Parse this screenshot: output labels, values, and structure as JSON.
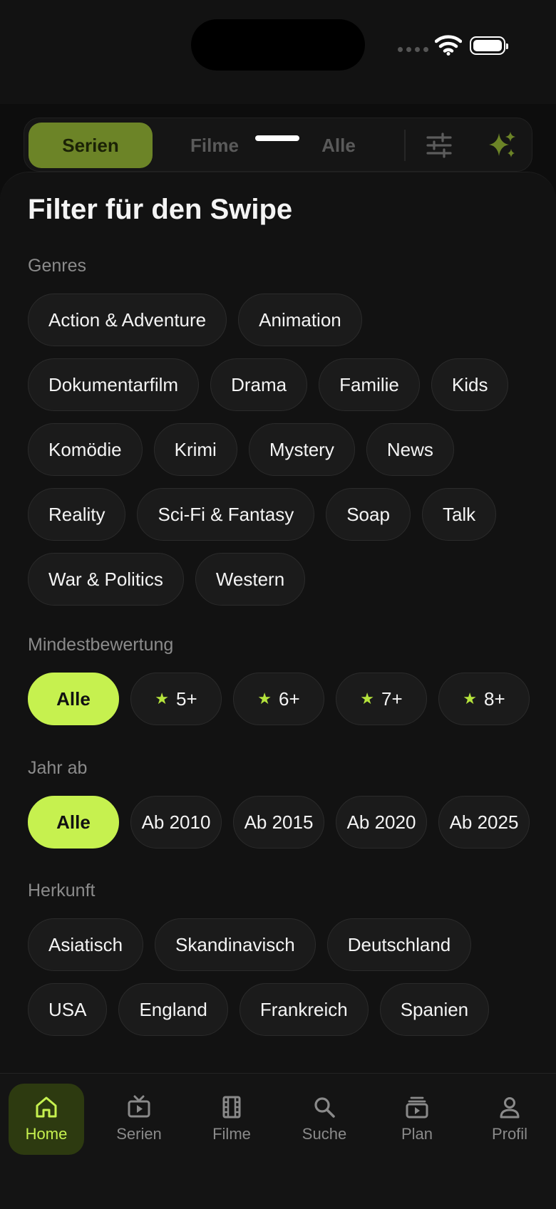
{
  "segments": {
    "serien": "Serien",
    "filme": "Filme",
    "alle": "Alle"
  },
  "sheet": {
    "title": "Filter für den Swipe",
    "genres": {
      "label": "Genres",
      "rows": [
        [
          "Action & Adventure",
          "Animation"
        ],
        [
          "Dokumentarfilm",
          "Drama",
          "Familie",
          "Kids"
        ],
        [
          "Komödie",
          "Krimi",
          "Mystery",
          "News"
        ],
        [
          "Reality",
          "Sci-Fi & Fantasy",
          "Soap",
          "Talk"
        ],
        [
          "War & Politics",
          "Western"
        ]
      ]
    },
    "rating": {
      "label": "Mindestbewertung",
      "all": "Alle",
      "options": [
        "5+",
        "6+",
        "7+",
        "8+"
      ],
      "selected": "Alle"
    },
    "year": {
      "label": "Jahr ab",
      "options": [
        "Alle",
        "Ab 2010",
        "Ab 2015",
        "Ab 2020",
        "Ab 2025"
      ],
      "selected": "Alle"
    },
    "origin": {
      "label": "Herkunft",
      "rows": [
        [
          "Asiatisch",
          "Skandinavisch",
          "Deutschland"
        ],
        [
          "USA",
          "England",
          "Frankreich",
          "Spanien"
        ]
      ]
    }
  },
  "tabs": [
    "Home",
    "Serien",
    "Filme",
    "Suche",
    "Plan",
    "Profil"
  ],
  "colors": {
    "accent": "#c6f14f",
    "background": "#0d0d0d",
    "chip": "#1b1b1b"
  }
}
